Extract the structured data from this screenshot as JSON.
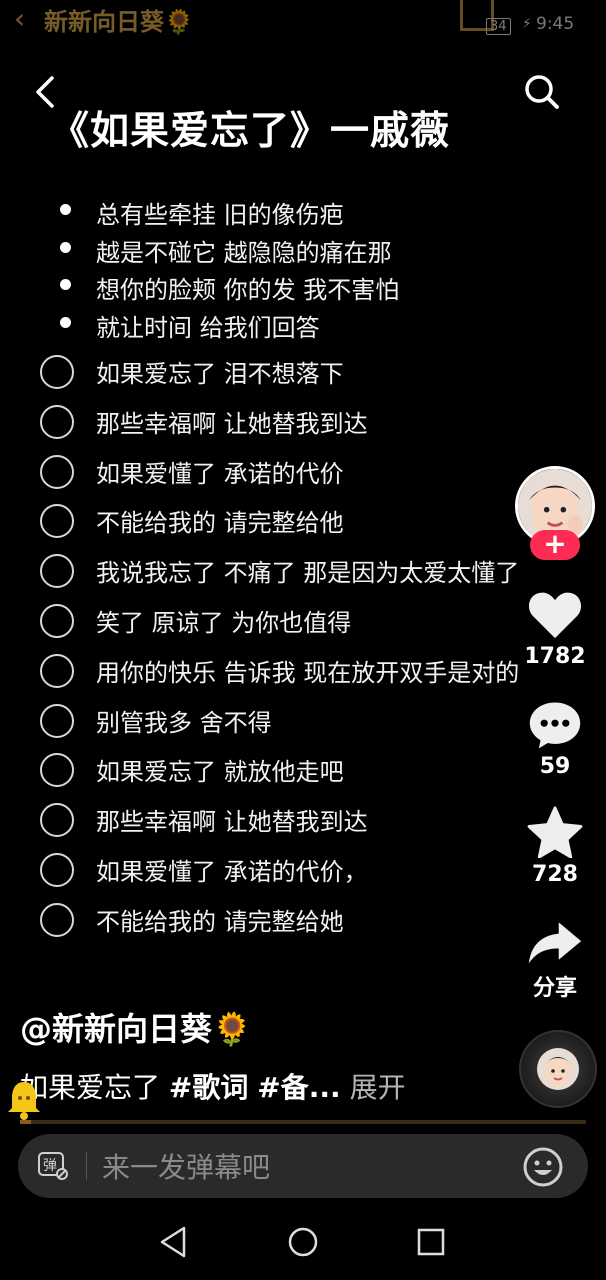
{
  "status_bar": {
    "owner_name": "新新向日葵🌻",
    "battery": "34",
    "time": "9:45"
  },
  "song_title": "《如果爱忘了》一戚薇",
  "bullet_lines": [
    "总有些牵挂 旧的像伤疤",
    "越是不碰它 越隐隐的痛在那",
    "想你的脸颊 你的发 我不害怕",
    "就让时间 给我们回答"
  ],
  "check_lines": [
    "如果爱忘了 泪不想落下",
    "那些幸福啊 让她替我到达",
    "如果爱懂了 承诺的代价",
    "不能给我的 请完整给他",
    "我说我忘了 不痛了 那是因为太爱太懂了",
    "笑了 原谅了 为你也值得",
    "用你的快乐 告诉我 现在放开双手是对的",
    "别管我多 舍不得",
    "如果爱忘了 就放他走吧",
    "那些幸福啊 让她替我到达",
    "如果爱懂了 承诺的代价，",
    "不能给我的 请完整给她"
  ],
  "rail": {
    "like_count": "1782",
    "comment_count": "59",
    "favorite_count": "728",
    "share_label": "分享"
  },
  "author": "@新新向日葵🌻",
  "caption": {
    "text": "如果爱忘了 ",
    "tag1": "#歌词",
    "tag2": "#备...",
    "expand": "展开"
  },
  "playback_progress": 0.02,
  "comment_input": {
    "placeholder": "来一发弹幕吧",
    "barrage_icon_text": "弹"
  },
  "colors": {
    "follow_red": "#fe2c55",
    "background": "#000000"
  },
  "icons": [
    "back-icon",
    "search-icon",
    "like-heart-icon",
    "comment-icon",
    "favorite-star-icon",
    "share-arrow-icon",
    "barrage-icon",
    "emoji-icon",
    "music-disc-icon"
  ]
}
